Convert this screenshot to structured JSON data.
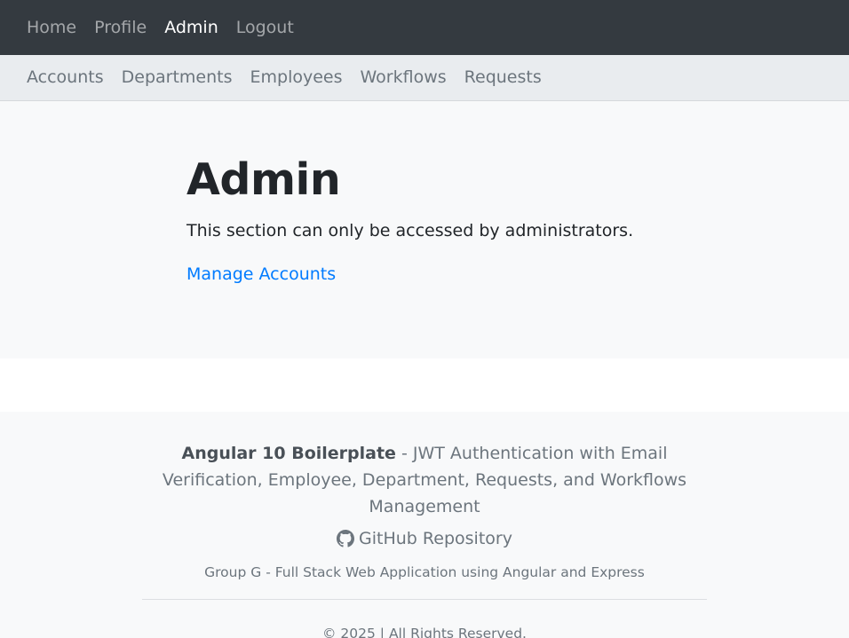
{
  "topnav": {
    "items": [
      "Home",
      "Profile",
      "Admin",
      "Logout"
    ],
    "active": "Admin"
  },
  "subnav": {
    "items": [
      "Accounts",
      "Departments",
      "Employees",
      "Workflows",
      "Requests"
    ]
  },
  "main": {
    "title": "Admin",
    "description": "This section can only be accessed by administrators.",
    "link": "Manage Accounts"
  },
  "footer": {
    "brand": "Angular 10 Boilerplate",
    "tagline": " - JWT Authentication with Email Verification, Employee, Department, Requests, and Workflows Management",
    "repo_icon": "github-icon",
    "repo_label": "GitHub Repository",
    "group": "Group G - Full Stack Web Application using Angular and Express",
    "copyright": "© 2025 | All Rights Reserved."
  },
  "colors": {
    "topnav_bg": "#343a40",
    "subnav_bg": "#e9ecef",
    "page_bg": "#f8f9fa",
    "link": "#007bff",
    "muted": "#6c757d"
  }
}
